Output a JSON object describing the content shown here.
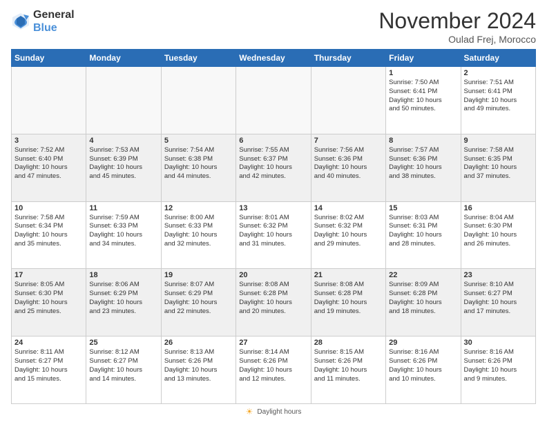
{
  "logo": {
    "line1": "General",
    "line2": "Blue"
  },
  "title": "November 2024",
  "location": "Oulad Frej, Morocco",
  "legend_text": "Daylight hours",
  "days_of_week": [
    "Sunday",
    "Monday",
    "Tuesday",
    "Wednesday",
    "Thursday",
    "Friday",
    "Saturday"
  ],
  "weeks": [
    [
      {
        "day": "",
        "content": ""
      },
      {
        "day": "",
        "content": ""
      },
      {
        "day": "",
        "content": ""
      },
      {
        "day": "",
        "content": ""
      },
      {
        "day": "",
        "content": ""
      },
      {
        "day": "1",
        "content": "Sunrise: 7:50 AM\nSunset: 6:41 PM\nDaylight: 10 hours\nand 50 minutes."
      },
      {
        "day": "2",
        "content": "Sunrise: 7:51 AM\nSunset: 6:41 PM\nDaylight: 10 hours\nand 49 minutes."
      }
    ],
    [
      {
        "day": "3",
        "content": "Sunrise: 7:52 AM\nSunset: 6:40 PM\nDaylight: 10 hours\nand 47 minutes."
      },
      {
        "day": "4",
        "content": "Sunrise: 7:53 AM\nSunset: 6:39 PM\nDaylight: 10 hours\nand 45 minutes."
      },
      {
        "day": "5",
        "content": "Sunrise: 7:54 AM\nSunset: 6:38 PM\nDaylight: 10 hours\nand 44 minutes."
      },
      {
        "day": "6",
        "content": "Sunrise: 7:55 AM\nSunset: 6:37 PM\nDaylight: 10 hours\nand 42 minutes."
      },
      {
        "day": "7",
        "content": "Sunrise: 7:56 AM\nSunset: 6:36 PM\nDaylight: 10 hours\nand 40 minutes."
      },
      {
        "day": "8",
        "content": "Sunrise: 7:57 AM\nSunset: 6:36 PM\nDaylight: 10 hours\nand 38 minutes."
      },
      {
        "day": "9",
        "content": "Sunrise: 7:58 AM\nSunset: 6:35 PM\nDaylight: 10 hours\nand 37 minutes."
      }
    ],
    [
      {
        "day": "10",
        "content": "Sunrise: 7:58 AM\nSunset: 6:34 PM\nDaylight: 10 hours\nand 35 minutes."
      },
      {
        "day": "11",
        "content": "Sunrise: 7:59 AM\nSunset: 6:33 PM\nDaylight: 10 hours\nand 34 minutes."
      },
      {
        "day": "12",
        "content": "Sunrise: 8:00 AM\nSunset: 6:33 PM\nDaylight: 10 hours\nand 32 minutes."
      },
      {
        "day": "13",
        "content": "Sunrise: 8:01 AM\nSunset: 6:32 PM\nDaylight: 10 hours\nand 31 minutes."
      },
      {
        "day": "14",
        "content": "Sunrise: 8:02 AM\nSunset: 6:32 PM\nDaylight: 10 hours\nand 29 minutes."
      },
      {
        "day": "15",
        "content": "Sunrise: 8:03 AM\nSunset: 6:31 PM\nDaylight: 10 hours\nand 28 minutes."
      },
      {
        "day": "16",
        "content": "Sunrise: 8:04 AM\nSunset: 6:30 PM\nDaylight: 10 hours\nand 26 minutes."
      }
    ],
    [
      {
        "day": "17",
        "content": "Sunrise: 8:05 AM\nSunset: 6:30 PM\nDaylight: 10 hours\nand 25 minutes."
      },
      {
        "day": "18",
        "content": "Sunrise: 8:06 AM\nSunset: 6:29 PM\nDaylight: 10 hours\nand 23 minutes."
      },
      {
        "day": "19",
        "content": "Sunrise: 8:07 AM\nSunset: 6:29 PM\nDaylight: 10 hours\nand 22 minutes."
      },
      {
        "day": "20",
        "content": "Sunrise: 8:08 AM\nSunset: 6:28 PM\nDaylight: 10 hours\nand 20 minutes."
      },
      {
        "day": "21",
        "content": "Sunrise: 8:08 AM\nSunset: 6:28 PM\nDaylight: 10 hours\nand 19 minutes."
      },
      {
        "day": "22",
        "content": "Sunrise: 8:09 AM\nSunset: 6:28 PM\nDaylight: 10 hours\nand 18 minutes."
      },
      {
        "day": "23",
        "content": "Sunrise: 8:10 AM\nSunset: 6:27 PM\nDaylight: 10 hours\nand 17 minutes."
      }
    ],
    [
      {
        "day": "24",
        "content": "Sunrise: 8:11 AM\nSunset: 6:27 PM\nDaylight: 10 hours\nand 15 minutes."
      },
      {
        "day": "25",
        "content": "Sunrise: 8:12 AM\nSunset: 6:27 PM\nDaylight: 10 hours\nand 14 minutes."
      },
      {
        "day": "26",
        "content": "Sunrise: 8:13 AM\nSunset: 6:26 PM\nDaylight: 10 hours\nand 13 minutes."
      },
      {
        "day": "27",
        "content": "Sunrise: 8:14 AM\nSunset: 6:26 PM\nDaylight: 10 hours\nand 12 minutes."
      },
      {
        "day": "28",
        "content": "Sunrise: 8:15 AM\nSunset: 6:26 PM\nDaylight: 10 hours\nand 11 minutes."
      },
      {
        "day": "29",
        "content": "Sunrise: 8:16 AM\nSunset: 6:26 PM\nDaylight: 10 hours\nand 10 minutes."
      },
      {
        "day": "30",
        "content": "Sunrise: 8:16 AM\nSunset: 6:26 PM\nDaylight: 10 hours\nand 9 minutes."
      }
    ]
  ]
}
